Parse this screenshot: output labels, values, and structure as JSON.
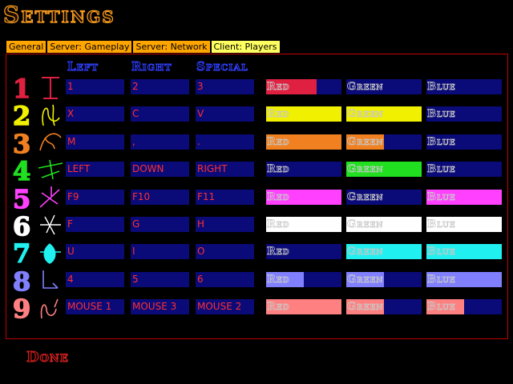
{
  "title": "Settings",
  "tabs": [
    "General",
    "Server: Gameplay",
    "Server: Network",
    "Client: Players"
  ],
  "active_tab": "Client: Players",
  "columns": {
    "left": "Left",
    "right": "Right",
    "special": "Special"
  },
  "color_labels": {
    "red": "Red",
    "green": "Green",
    "blue": "Blue"
  },
  "players": [
    {
      "number": "1",
      "color": "#e02040",
      "left": "1",
      "right": "2",
      "special": "3",
      "red": 0.67,
      "green": 0,
      "blue": 0
    },
    {
      "number": "2",
      "color": "#f0f000",
      "left": "X",
      "right": "C",
      "special": "V",
      "red": 1.0,
      "green": 1.0,
      "blue": 0
    },
    {
      "number": "3",
      "color": "#f08020",
      "left": "M",
      "right": ",",
      "special": ".",
      "red": 1.0,
      "green": 0.5,
      "blue": 0
    },
    {
      "number": "4",
      "color": "#20e020",
      "left": "LEFT",
      "right": "DOWN",
      "special": "RIGHT",
      "red": 0,
      "green": 1.0,
      "blue": 0
    },
    {
      "number": "5",
      "color": "#ff40ff",
      "left": "F9",
      "right": "F10",
      "special": "F11",
      "red": 1.0,
      "green": 0,
      "blue": 1.0
    },
    {
      "number": "6",
      "color": "#ffffff",
      "left": "F",
      "right": "G",
      "special": "H",
      "red": 1.0,
      "green": 1.0,
      "blue": 1.0
    },
    {
      "number": "7",
      "color": "#20f0f0",
      "left": "U",
      "right": "I",
      "special": "O",
      "red": 0,
      "green": 1.0,
      "blue": 1.0
    },
    {
      "number": "8",
      "color": "#8080ff",
      "left": "4",
      "right": "5",
      "special": "6",
      "red": 0.5,
      "green": 0.5,
      "blue": 1.0
    },
    {
      "number": "9",
      "color": "#ff8080",
      "left": "MOUSE 1",
      "right": "MOUSE 3",
      "special": "MOUSE 2",
      "red": 1.0,
      "green": 0.5,
      "blue": 0.5
    }
  ],
  "done_label": "Done"
}
